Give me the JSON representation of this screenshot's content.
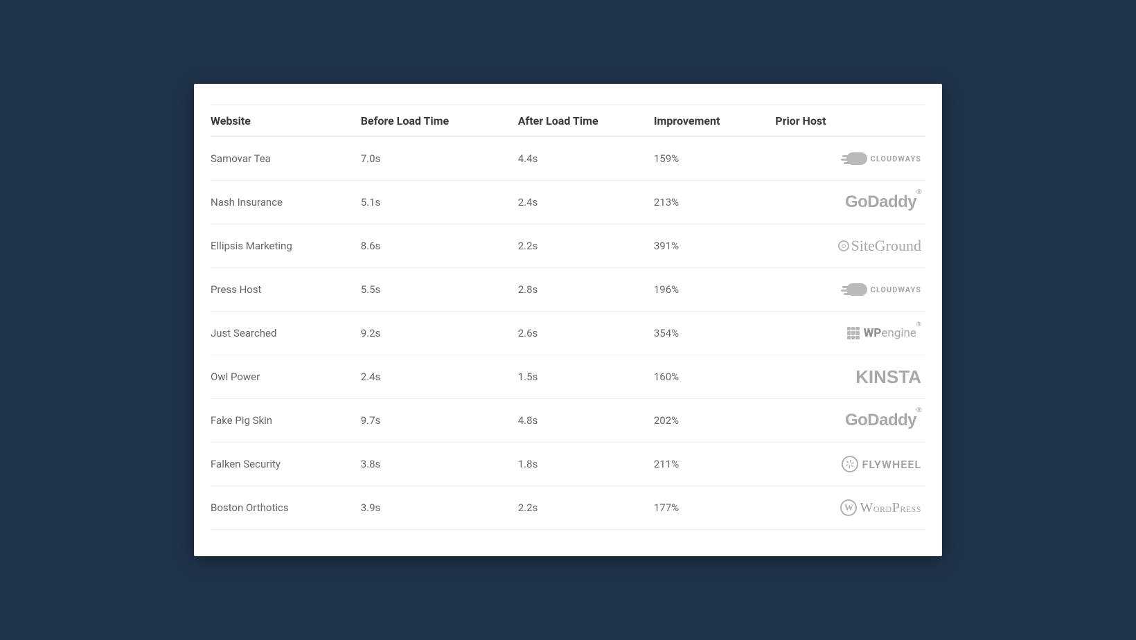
{
  "table": {
    "columns": [
      "Website",
      "Before Load Time",
      "After Load Time",
      "Improvement",
      "Prior Host"
    ],
    "rows": [
      {
        "website": "Samovar Tea",
        "before": "7.0s",
        "after": "4.4s",
        "improvement": "159%",
        "host": "cloudways",
        "host_name": "Cloudways"
      },
      {
        "website": "Nash Insurance",
        "before": "5.1s",
        "after": "2.4s",
        "improvement": "213%",
        "host": "godaddy",
        "host_name": "GoDaddy"
      },
      {
        "website": "Ellipsis Marketing",
        "before": "8.6s",
        "after": "2.2s",
        "improvement": "391%",
        "host": "siteground",
        "host_name": "SiteGround"
      },
      {
        "website": "Press Host",
        "before": "5.5s",
        "after": "2.8s",
        "improvement": "196%",
        "host": "cloudways",
        "host_name": "Cloudways"
      },
      {
        "website": "Just Searched",
        "before": "9.2s",
        "after": "2.6s",
        "improvement": "354%",
        "host": "wpengine",
        "host_name": "WP Engine"
      },
      {
        "website": "Owl Power",
        "before": "2.4s",
        "after": "1.5s",
        "improvement": "160%",
        "host": "kinsta",
        "host_name": "Kinsta"
      },
      {
        "website": "Fake Pig Skin",
        "before": "9.7s",
        "after": "4.8s",
        "improvement": "202%",
        "host": "godaddy",
        "host_name": "GoDaddy"
      },
      {
        "website": "Falken Security",
        "before": "3.8s",
        "after": "1.8s",
        "improvement": "211%",
        "host": "flywheel",
        "host_name": "Flywheel"
      },
      {
        "website": "Boston Orthotics",
        "before": "3.9s",
        "after": "2.2s",
        "improvement": "177%",
        "host": "wordpress",
        "host_name": "WordPress"
      }
    ]
  }
}
